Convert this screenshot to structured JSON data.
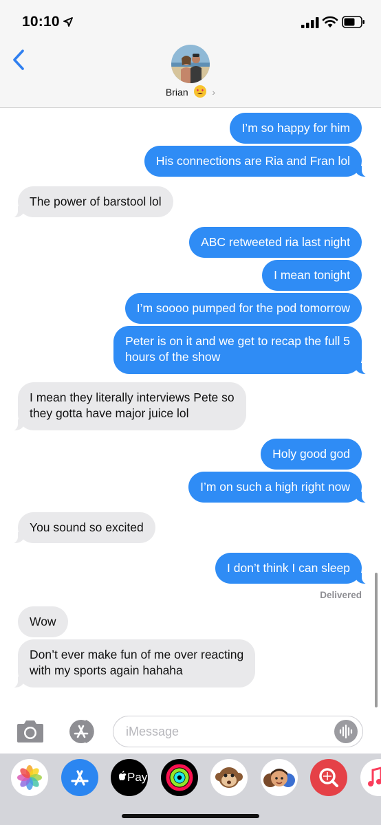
{
  "status": {
    "time": "10:10"
  },
  "contact": {
    "name": "Brian"
  },
  "messages": [
    {
      "dir": "sent",
      "lines": [
        "I’m so happy for him"
      ]
    },
    {
      "dir": "sent",
      "lines": [
        "His connections are Ria and Fran lol"
      ]
    },
    {
      "dir": "recv",
      "lines": [
        "The power of barstool lol"
      ]
    },
    {
      "dir": "sent",
      "lines": [
        "ABC retweeted ria last night"
      ]
    },
    {
      "dir": "sent",
      "lines": [
        "I mean tonight"
      ]
    },
    {
      "dir": "sent",
      "lines": [
        "I’m soooo pumped for the pod tomorrow"
      ]
    },
    {
      "dir": "sent",
      "lines": [
        "Peter is on it and we get to recap the full 5",
        "hours of the show"
      ]
    },
    {
      "dir": "recv",
      "lines": [
        "I mean they literally interviews Pete so",
        "they gotta have major juice lol"
      ]
    },
    {
      "dir": "sent",
      "lines": [
        "Holy good god"
      ]
    },
    {
      "dir": "sent",
      "lines": [
        "I’m on such a high right now"
      ]
    },
    {
      "dir": "recv",
      "lines": [
        "You sound so excited"
      ]
    },
    {
      "dir": "sent",
      "lines": [
        "I don’t think I can sleep"
      ]
    },
    {
      "dir": "recv",
      "lines": [
        "Wow"
      ]
    },
    {
      "dir": "recv",
      "lines": [
        "Don’t ever make fun of me over reacting",
        "with my sports again hahaha"
      ]
    }
  ],
  "delivered_label": "Delivered",
  "input": {
    "placeholder": "iMessage"
  },
  "apps": [
    {
      "name": "photos-app-icon"
    },
    {
      "name": "app-store-app-icon"
    },
    {
      "name": "apple-pay-app-icon",
      "label": "Pay"
    },
    {
      "name": "activity-app-icon"
    },
    {
      "name": "animoji-app-icon"
    },
    {
      "name": "memoji-app-icon"
    },
    {
      "name": "search-images-app-icon"
    },
    {
      "name": "music-app-icon"
    }
  ],
  "colors": {
    "sent": "#2f8cf5",
    "received": "#e9e9eb",
    "ios_blue": "#2f7ff0"
  }
}
